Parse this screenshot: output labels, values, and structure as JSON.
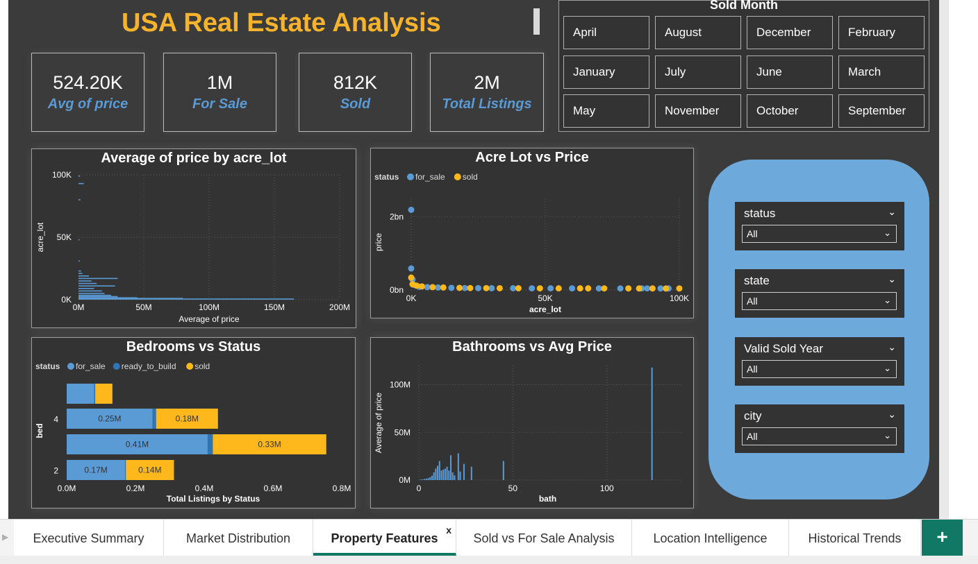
{
  "title": "USA Real Estate Analysis",
  "kpis": [
    {
      "value": "524.20K",
      "label": "Avg of price"
    },
    {
      "value": "1M",
      "label": "For Sale"
    },
    {
      "value": "812K",
      "label": "Sold"
    },
    {
      "value": "2M",
      "label": "Total Listings"
    }
  ],
  "sold_month": {
    "title": "Sold Month",
    "months": [
      "April",
      "August",
      "December",
      "February",
      "January",
      "July",
      "June",
      "March",
      "May",
      "November",
      "October",
      "September"
    ]
  },
  "filters": [
    {
      "label": "status",
      "value": "All"
    },
    {
      "label": "state",
      "value": "All"
    },
    {
      "label": "Valid Sold Year",
      "value": "All"
    },
    {
      "label": "city",
      "value": "All"
    }
  ],
  "tabs": [
    {
      "label": "Executive Summary",
      "active": false
    },
    {
      "label": "Market Distribution",
      "active": false
    },
    {
      "label": "Property Features",
      "active": true
    },
    {
      "label": "Sold vs For Sale Analysis",
      "active": false
    },
    {
      "label": "Location Intelligence",
      "active": false
    },
    {
      "label": "Historical Trends",
      "active": false
    }
  ],
  "tab_close": "x",
  "add_tab": "+",
  "colors": {
    "for_sale": "#5b9bd5",
    "ready_to_build": "#2e75b6",
    "sold": "#ffb81c",
    "title": "#f7b32b",
    "accent": "#117865"
  },
  "chart_data": [
    {
      "id": "price_by_acre",
      "type": "bar",
      "orientation": "horizontal",
      "title": "Average of price by acre_lot",
      "xlabel": "Average of price",
      "ylabel": "acre_lot",
      "xlim": [
        0,
        200000000
      ],
      "ylim": [
        0,
        100000
      ],
      "xticks": [
        "0M",
        "50M",
        "100M",
        "150M",
        "200M"
      ],
      "yticks": [
        "0K",
        "50K",
        "100K"
      ],
      "points": [
        {
          "y": 500,
          "x": 165000000
        },
        {
          "y": 1000,
          "x": 80000000
        },
        {
          "y": 1500,
          "x": 45000000
        },
        {
          "y": 2500,
          "x": 30000000
        },
        {
          "y": 3500,
          "x": 25000000
        },
        {
          "y": 5000,
          "x": 20000000
        },
        {
          "y": 7000,
          "x": 18000000
        },
        {
          "y": 9000,
          "x": 12000000
        },
        {
          "y": 11000,
          "x": 28000000
        },
        {
          "y": 13000,
          "x": 14000000
        },
        {
          "y": 15000,
          "x": 10000000
        },
        {
          "y": 17000,
          "x": 30000000
        },
        {
          "y": 19000,
          "x": 8000000
        },
        {
          "y": 21000,
          "x": 3000000
        },
        {
          "y": 23000,
          "x": 2000000
        },
        {
          "y": 31000,
          "x": 1000000
        },
        {
          "y": 48000,
          "x": 700000
        },
        {
          "y": 80000,
          "x": 1500000
        },
        {
          "y": 93000,
          "x": 4000000
        },
        {
          "y": 99000,
          "x": 1200000
        }
      ]
    },
    {
      "id": "acre_vs_price",
      "type": "scatter",
      "title": "Acre Lot vs Price",
      "xlabel": "acre_lot",
      "ylabel": "price",
      "legend_title": "status",
      "xlim": [
        0,
        100000
      ],
      "ylim": [
        0,
        2500000000
      ],
      "xticks": [
        "0K",
        "50K",
        "100K"
      ],
      "yticks": [
        "0bn",
        "2bn"
      ],
      "series": [
        {
          "name": "for_sale",
          "points": [
            [
              0,
              2150000000
            ],
            [
              0,
              550000000
            ],
            [
              500,
              250000000
            ],
            [
              1000,
              100000000
            ],
            [
              3000,
              50000000
            ],
            [
              6000,
              40000000
            ],
            [
              10000,
              30000000
            ],
            [
              15000,
              20000000
            ],
            [
              20000,
              15000000
            ],
            [
              25000,
              12000000
            ],
            [
              30000,
              10000000
            ],
            [
              38000,
              10000000
            ],
            [
              45000,
              8000000
            ],
            [
              52000,
              8000000
            ],
            [
              60000,
              6000000
            ],
            [
              70000,
              5000000
            ],
            [
              78000,
              5000000
            ],
            [
              86000,
              5000000
            ],
            [
              88000,
              5000000
            ],
            [
              93000,
              4000000
            ],
            [
              96000,
              4000000
            ]
          ]
        },
        {
          "name": "sold",
          "points": [
            [
              0,
              300000000
            ],
            [
              500,
              120000000
            ],
            [
              2000,
              80000000
            ],
            [
              4000,
              60000000
            ],
            [
              8000,
              40000000
            ],
            [
              12000,
              30000000
            ],
            [
              18000,
              20000000
            ],
            [
              22000,
              15000000
            ],
            [
              28000,
              12000000
            ],
            [
              33000,
              10000000
            ],
            [
              40000,
              9000000
            ],
            [
              48000,
              8000000
            ],
            [
              55000,
              7000000
            ],
            [
              63000,
              6000000
            ],
            [
              66000,
              6000000
            ],
            [
              72000,
              5000000
            ],
            [
              81000,
              5000000
            ],
            [
              85000,
              4000000
            ],
            [
              90000,
              4000000
            ],
            [
              95000,
              3000000
            ],
            [
              100000,
              3000000
            ]
          ]
        }
      ]
    },
    {
      "id": "bedrooms_vs_status",
      "type": "bar",
      "orientation": "horizontal",
      "stacked": true,
      "title": "Bedrooms vs Status",
      "xlabel": "Total Listings by Status",
      "ylabel": "bed",
      "legend_title": "status",
      "xlim": [
        0,
        800000
      ],
      "xticks": [
        "0.0M",
        "0.2M",
        "0.4M",
        "0.6M",
        "0.8M"
      ],
      "categories": [
        "",
        "4",
        "",
        "2"
      ],
      "series": [
        {
          "name": "for_sale",
          "values": [
            80000,
            250000,
            410000,
            170000
          ],
          "labels": [
            "",
            "0.25M",
            "0.41M",
            "0.17M"
          ]
        },
        {
          "name": "ready_to_build",
          "values": [
            3000,
            10000,
            15000,
            2000
          ],
          "labels": [
            "",
            "",
            "",
            ""
          ]
        },
        {
          "name": "sold",
          "values": [
            50000,
            180000,
            330000,
            140000
          ],
          "labels": [
            "",
            "0.18M",
            "0.33M",
            "0.14M"
          ]
        }
      ]
    },
    {
      "id": "bath_vs_avg_price",
      "type": "bar",
      "title": "Bathrooms vs Avg Price",
      "xlabel": "bath",
      "ylabel": "Average of price",
      "xlim": [
        0,
        140
      ],
      "ylim": [
        0,
        120000000
      ],
      "xticks": [
        "0",
        "50",
        "100"
      ],
      "yticks": [
        "0M",
        "50M",
        "100M"
      ],
      "points": [
        [
          1,
          500000
        ],
        [
          2,
          800000
        ],
        [
          3,
          1200000
        ],
        [
          4,
          1500000
        ],
        [
          5,
          2000000
        ],
        [
          6,
          3000000
        ],
        [
          7,
          4500000
        ],
        [
          8,
          8000000
        ],
        [
          9,
          12000000
        ],
        [
          10,
          15000000
        ],
        [
          11,
          20000000
        ],
        [
          12,
          10000000
        ],
        [
          13,
          11000000
        ],
        [
          14,
          12000000
        ],
        [
          15,
          14000000
        ],
        [
          16,
          10000000
        ],
        [
          17,
          26000000
        ],
        [
          18,
          8000000
        ],
        [
          19,
          5000000
        ],
        [
          21,
          28000000
        ],
        [
          22,
          9000000
        ],
        [
          24,
          17000000
        ],
        [
          28,
          14000000
        ],
        [
          45,
          20000000
        ],
        [
          124,
          118000000
        ]
      ]
    }
  ]
}
